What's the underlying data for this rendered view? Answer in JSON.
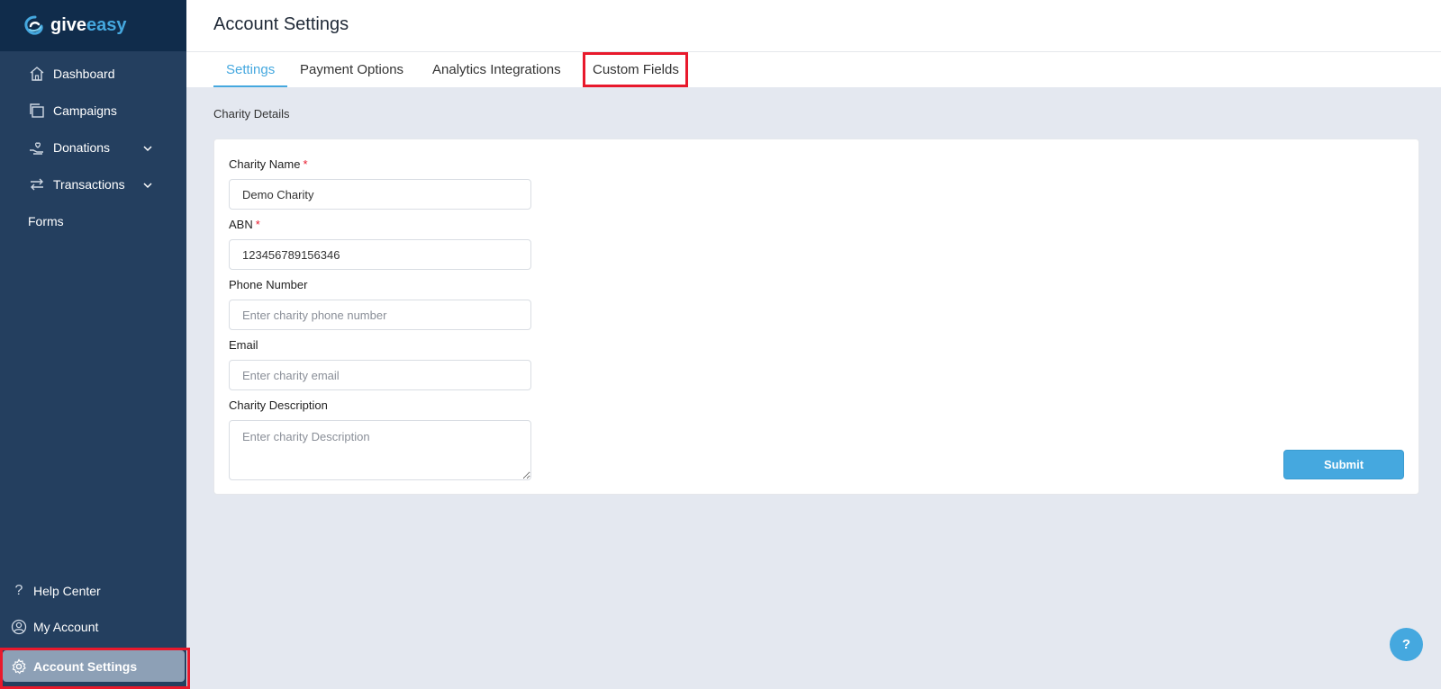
{
  "brand": {
    "give": "give",
    "easy": "easy"
  },
  "sidebar": {
    "items": [
      {
        "label": "Dashboard",
        "icon": "home-icon"
      },
      {
        "label": "Campaigns",
        "icon": "folders-icon"
      },
      {
        "label": "Donations",
        "icon": "hand-heart-icon",
        "expandable": true
      },
      {
        "label": "Transactions",
        "icon": "arrows-exchange-icon",
        "expandable": true
      },
      {
        "label": "Forms"
      }
    ],
    "bottom": [
      {
        "label": "Help Center",
        "icon": "question-icon"
      },
      {
        "label": "My Account",
        "icon": "user-circle-icon"
      },
      {
        "label": "Account Settings",
        "icon": "gear-icon",
        "active": true
      }
    ]
  },
  "header": {
    "title": "Account Settings"
  },
  "tabs": [
    {
      "label": "Settings",
      "active": true
    },
    {
      "label": "Payment Options"
    },
    {
      "label": "Analytics Integrations"
    },
    {
      "label": "Custom Fields",
      "highlighted": true
    }
  ],
  "section": {
    "label": "Charity Details"
  },
  "form": {
    "charity_name": {
      "label": "Charity Name",
      "required": "*",
      "value": "Demo Charity"
    },
    "abn": {
      "label": "ABN",
      "required": "*",
      "value": "123456789156346"
    },
    "phone": {
      "label": "Phone Number",
      "placeholder": "Enter charity phone number"
    },
    "email": {
      "label": "Email",
      "placeholder": "Enter charity email"
    },
    "description": {
      "label": "Charity Description",
      "placeholder": "Enter charity Description"
    },
    "submit_label": "Submit"
  },
  "help_fab": "?",
  "colors": {
    "accent": "#45a8df",
    "sidebar": "#243f5f",
    "highlight": "#e8192c"
  }
}
